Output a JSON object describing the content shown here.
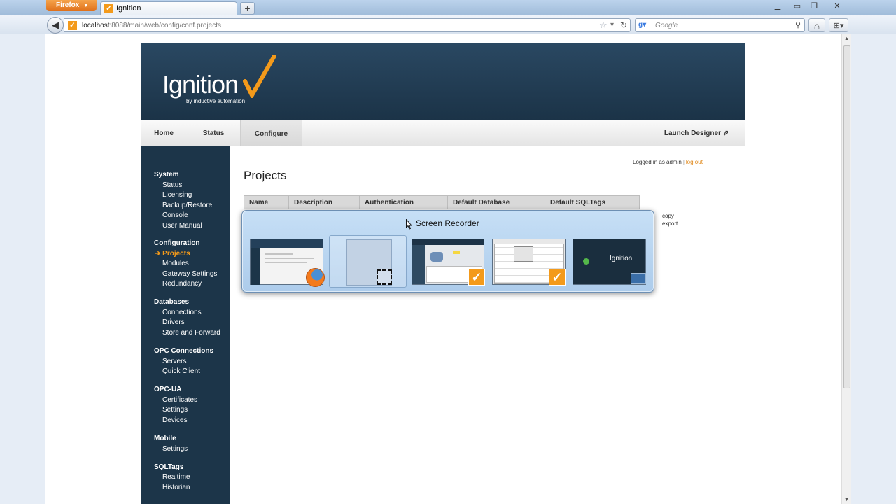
{
  "browser": {
    "menu_button": "Firefox",
    "tab_title": "Ignition",
    "new_tab": "+",
    "url_host": "localhost",
    "url_rest": ":8088/main/web/config/conf.projects",
    "search_placeholder": "Google"
  },
  "header": {
    "logo": "Ignition",
    "logo_sub": "by inductive automation"
  },
  "topnav": {
    "home": "Home",
    "status": "Status",
    "configure": "Configure",
    "launch": "Launch Designer"
  },
  "sidebar": {
    "sections": [
      {
        "title": "System",
        "items": [
          "Status",
          "Licensing",
          "Backup/Restore",
          "Console",
          "User Manual"
        ]
      },
      {
        "title": "Configuration",
        "items": [
          "Projects",
          "Modules",
          "Gateway Settings",
          "Redundancy"
        ]
      },
      {
        "title": "Databases",
        "items": [
          "Connections",
          "Drivers",
          "Store and Forward"
        ]
      },
      {
        "title": "OPC Connections",
        "items": [
          "Servers",
          "Quick Client"
        ]
      },
      {
        "title": "OPC-UA",
        "items": [
          "Certificates",
          "Settings",
          "Devices"
        ]
      },
      {
        "title": "Mobile",
        "items": [
          "Settings"
        ]
      },
      {
        "title": "SQLTags",
        "items": [
          "Realtime",
          "Historian"
        ]
      }
    ],
    "active_prefix": "➔ "
  },
  "main": {
    "logged_in": "Logged in as admin",
    "separator": "|",
    "logout": "log out",
    "title": "Projects",
    "columns": [
      "Name",
      "Description",
      "Authentication",
      "Default Database",
      "Default SQLTags"
    ],
    "actions": [
      "copy",
      "export"
    ]
  },
  "switcher": {
    "title": "Screen Recorder"
  },
  "colors": {
    "banner": "#1f3a50",
    "sidebar": "#1c3549",
    "accent": "#f39a1b"
  }
}
